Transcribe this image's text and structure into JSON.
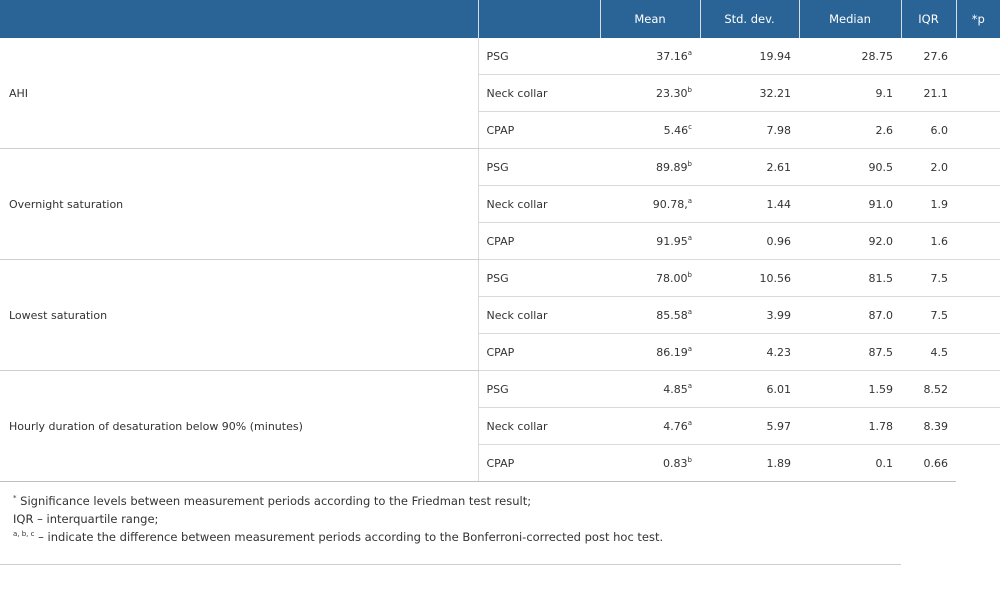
{
  "table": {
    "headers": [
      "",
      "",
      "Mean",
      "Std. dev.",
      "Median",
      "IQR",
      "*p"
    ],
    "groups": [
      {
        "label": "AHI",
        "rows": [
          {
            "condition": "PSG",
            "mean": "37.16",
            "sup": "a",
            "sd": "19.94",
            "median": "28.75",
            "iqr": "27.6"
          },
          {
            "condition": "Neck collar",
            "mean": "23.30",
            "sup": "b",
            "sd": "32.21",
            "median": "9.1",
            "iqr": "21.1"
          },
          {
            "condition": "CPAP",
            "mean": "5.46",
            "sup": "c",
            "sd": "7.98",
            "median": "2.6",
            "iqr": "6.0"
          }
        ]
      },
      {
        "label": "Overnight saturation",
        "rows": [
          {
            "condition": "PSG",
            "mean": "89.89",
            "sup": "b",
            "sd": "2.61",
            "median": "90.5",
            "iqr": "2.0"
          },
          {
            "condition": "Neck collar",
            "mean": "90.78,",
            "sup": "a",
            "sd": "1.44",
            "median": "91.0",
            "iqr": "1.9"
          },
          {
            "condition": "CPAP",
            "mean": "91.95",
            "sup": "a",
            "sd": "0.96",
            "median": "92.0",
            "iqr": "1.6"
          }
        ]
      },
      {
        "label": "Lowest saturation",
        "rows": [
          {
            "condition": "PSG",
            "mean": "78.00",
            "sup": "b",
            "sd": "10.56",
            "median": "81.5",
            "iqr": "7.5"
          },
          {
            "condition": "Neck collar",
            "mean": "85.58",
            "sup": "a",
            "sd": "3.99",
            "median": "87.0",
            "iqr": "7.5"
          },
          {
            "condition": "CPAP",
            "mean": "86.19",
            "sup": "a",
            "sd": "4.23",
            "median": "87.5",
            "iqr": "4.5"
          }
        ]
      },
      {
        "label": "Hourly duration of desaturation below 90% (minutes)",
        "rows": [
          {
            "condition": "PSG",
            "mean": "4.85",
            "sup": "a",
            "sd": "6.01",
            "median": "1.59",
            "iqr": "8.52"
          },
          {
            "condition": "Neck collar",
            "mean": "4.76",
            "sup": "a",
            "sd": "5.97",
            "median": "1.78",
            "iqr": "8.39"
          },
          {
            "condition": "CPAP",
            "mean": "0.83",
            "sup": "b",
            "sd": "1.89",
            "median": "0.1",
            "iqr": "0.66"
          }
        ]
      }
    ]
  },
  "footnotes": [
    {
      "sup": "*",
      "text": " Significance levels between measurement periods according to the Friedman test result;"
    },
    {
      "sup": "",
      "text": "IQR – interquartile range;"
    },
    {
      "sup": "a, b, c",
      "text": " – indicate the difference between measurement periods according to the Bonferroni-corrected post hoc test."
    }
  ]
}
